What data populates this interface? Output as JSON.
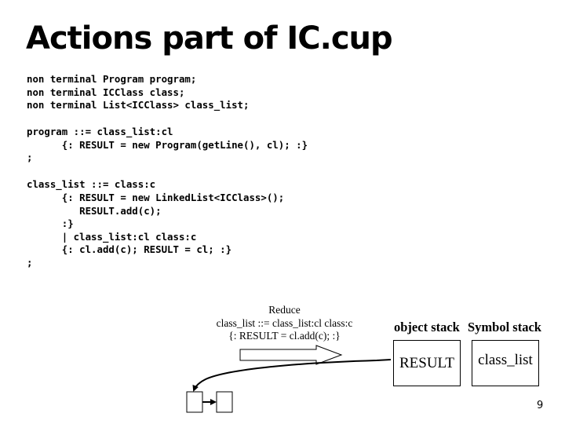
{
  "slide": {
    "title": "Actions part of IC.cup",
    "declarations": [
      "non terminal Program program;",
      "non terminal ICClass class;",
      "non terminal List<ICClass> class_list;"
    ],
    "program_rule": [
      "program ::= class_list:cl",
      "      {: RESULT = new Program(getLine(), cl); :}",
      ";"
    ],
    "class_list_rule": [
      "class_list ::= class:c",
      "      {: RESULT = new LinkedList<ICClass>();",
      "         RESULT.add(c);",
      "      :}",
      "      | class_list:cl class:c",
      "      {: cl.add(c); RESULT = cl; :}",
      ";"
    ],
    "page_number": "9"
  },
  "diagram": {
    "caption": [
      "Reduce",
      "class_list ::= class_list:cl class:c",
      "{: RESULT = cl.add(c); :}"
    ],
    "object_stack_label": "object stack",
    "symbol_stack_label": "Symbol stack",
    "object_stack_top": "RESULT",
    "symbol_stack_top": "class_list"
  }
}
